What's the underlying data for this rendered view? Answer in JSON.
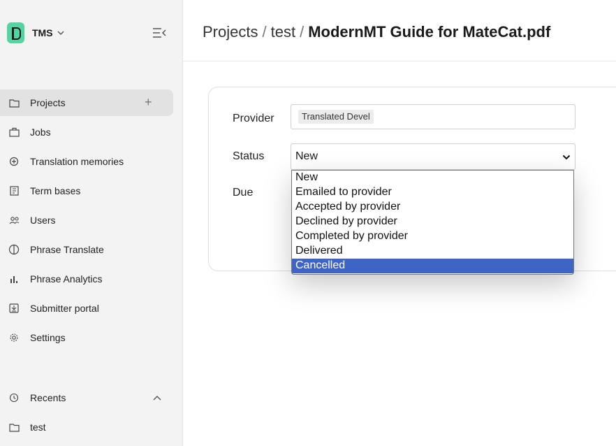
{
  "sidebar": {
    "brand": "TMS",
    "nav": [
      {
        "label": "Projects",
        "icon": "folder-icon",
        "active": true
      },
      {
        "label": "Jobs",
        "icon": "briefcase-icon"
      },
      {
        "label": "Translation memories",
        "icon": "database-icon"
      },
      {
        "label": "Term bases",
        "icon": "book-icon"
      },
      {
        "label": "Users",
        "icon": "users-icon"
      },
      {
        "label": "Phrase Translate",
        "icon": "brain-icon"
      },
      {
        "label": "Phrase Analytics",
        "icon": "analytics-icon"
      },
      {
        "label": "Submitter portal",
        "icon": "portal-icon"
      },
      {
        "label": "Settings",
        "icon": "gear-icon"
      }
    ],
    "projects_add": "+",
    "recents": {
      "label": "Recents",
      "items": [
        {
          "label": "test"
        }
      ]
    }
  },
  "header": {
    "crumbs": [
      "Projects",
      "test",
      "ModernMT Guide for MateCat.pdf"
    ],
    "separator": "/"
  },
  "form": {
    "provider_label": "Provider",
    "provider_value": "Translated Devel",
    "status_label": "Status",
    "status_value": "New",
    "due_label": "Due"
  },
  "status_options": [
    "New",
    "Emailed to provider",
    "Accepted by provider",
    "Declined by provider",
    "Completed by provider",
    "Delivered",
    "Cancelled"
  ],
  "highlighted_option": "Cancelled",
  "colors": {
    "accent": "#3e64c5",
    "logo": "#54d4a0",
    "sidebar_bg": "#f3f3f3"
  }
}
